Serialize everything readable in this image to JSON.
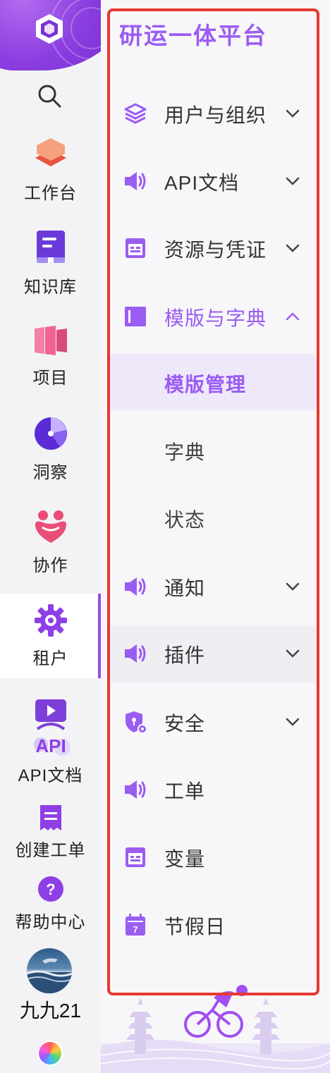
{
  "rail": {
    "items": [
      {
        "label": "工作台",
        "icon": "workbench-icon"
      },
      {
        "label": "知识库",
        "icon": "knowledge-book-icon"
      },
      {
        "label": "项目",
        "icon": "project-icon"
      },
      {
        "label": "洞察",
        "icon": "pie-chart-icon"
      },
      {
        "label": "协作",
        "icon": "collaboration-icon"
      },
      {
        "label": "租户",
        "icon": "gear-icon",
        "active": true
      },
      {
        "label": "API文档",
        "icon": "api-doc-icon"
      },
      {
        "label": "创建工单",
        "icon": "ticket-icon"
      },
      {
        "label": "帮助中心",
        "icon": "help-icon"
      }
    ],
    "api_badge": "API",
    "username": "九九21",
    "calendar_day": "7"
  },
  "panel": {
    "title": "研运一体平台",
    "menu": [
      {
        "label": "用户与组织",
        "icon": "layers-icon",
        "expandable": true
      },
      {
        "label": "API文档",
        "icon": "speaker-icon",
        "expandable": true
      },
      {
        "label": "资源与凭证",
        "icon": "window-icon",
        "expandable": true
      },
      {
        "label": "模版与字典",
        "icon": "template-icon",
        "expandable": true,
        "expanded": true,
        "children": [
          {
            "label": "模版管理",
            "selected": true
          },
          {
            "label": "字典"
          },
          {
            "label": "状态"
          }
        ]
      },
      {
        "label": "通知",
        "icon": "speaker-icon",
        "expandable": true
      },
      {
        "label": "插件",
        "icon": "speaker-icon",
        "expandable": true
      },
      {
        "label": "安全",
        "icon": "shield-gear-icon",
        "expandable": true
      },
      {
        "label": "工单",
        "icon": "speaker-icon",
        "expandable": false
      },
      {
        "label": "变量",
        "icon": "window-icon",
        "expandable": false
      },
      {
        "label": "节假日",
        "icon": "calendar-icon",
        "expandable": false
      }
    ]
  },
  "colors": {
    "accent": "#9b5cf2",
    "highlight_border": "#e6392f"
  }
}
